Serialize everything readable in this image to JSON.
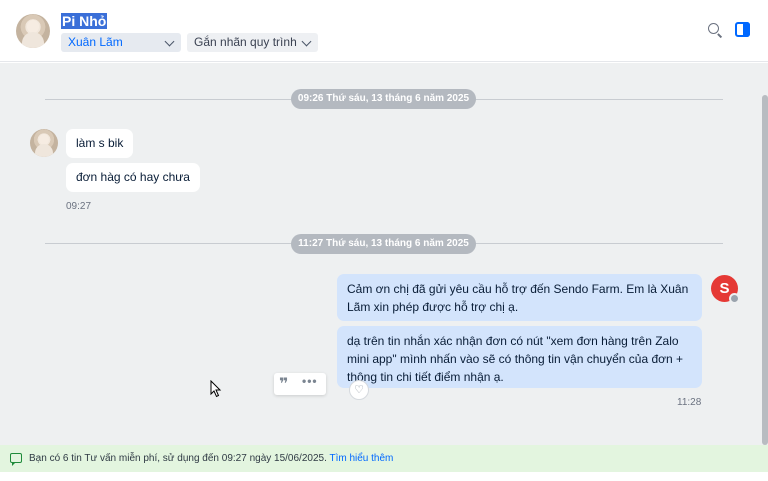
{
  "header": {
    "contact_name": "Pi Nhỏ",
    "assignee": "Xuân Lãm",
    "label_placeholder": "Gắn nhãn quy trình"
  },
  "messages": {
    "date1": "09:26 Thứ sáu, 13 tháng 6 năm 2025",
    "in1": "làm s bik",
    "in2": "đơn hàg có hay chưa",
    "in_time": "09:27",
    "date2": "11:27 Thứ sáu, 13 tháng 6 năm 2025",
    "out1": "Cảm ơn chị đã gửi yêu cầu hỗ trợ đến Sendo Farm. Em là Xuân Lãm xin phép được hỗ trợ chị ạ.",
    "out2": "dạ trên tin nhắn xác nhận đơn có nút \"xem đơn hàng trên Zalo mini app\" mình nhấn vào sẽ có thông tin vận chuyển của đơn + thông tin chi tiết điểm nhận ạ.",
    "out_time": "11:28",
    "sender_initial": "S"
  },
  "notice": {
    "text": "Bạn có 6 tin Tư vấn miễn phí, sử dụng đến 09:27 ngày 15/06/2025.",
    "link": "Tìm hiểu thêm"
  },
  "icons": {
    "search": "search-icon",
    "panel": "toggle-panel-icon",
    "quote": "quote-icon",
    "more": "more-icon",
    "react": "heart-icon"
  },
  "colors": {
    "accent": "#0068ff",
    "outgoing_bubble": "#d3e4fc",
    "notice_bg": "#e3f5df"
  }
}
